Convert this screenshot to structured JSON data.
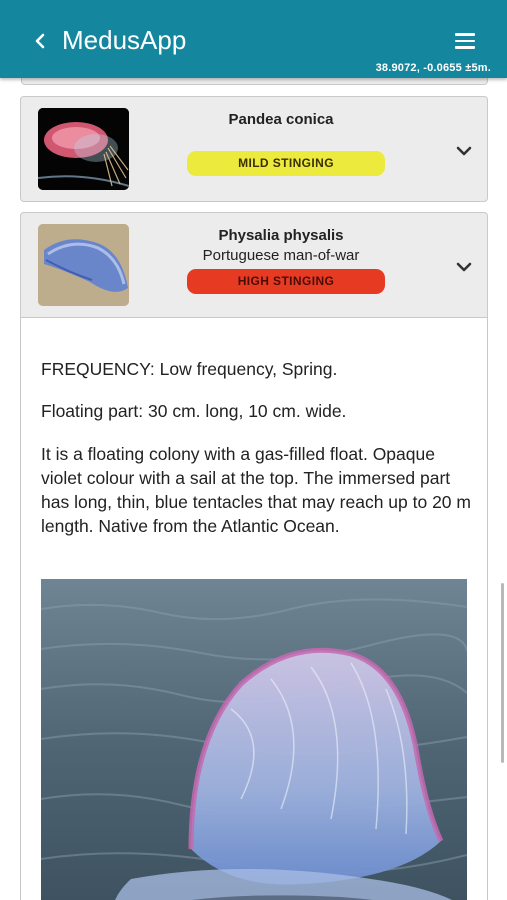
{
  "header": {
    "title": "MedusApp",
    "coordinates": "38.9072, -0.0655 ±5m.",
    "back_icon": "chevron-left-icon",
    "menu_icon": "hamburger-menu-icon",
    "background_color": "#14879f"
  },
  "cards": [
    {
      "species": "Pandea conica",
      "common_name": "",
      "sting_level": "MILD STINGING",
      "badge_color": "#ecea3c",
      "expand_icon": "chevron-down-icon"
    },
    {
      "species": "Physalia physalis",
      "common_name": "Portuguese man-of-war",
      "sting_level": "HIGH STINGING",
      "badge_color": "#e63a23",
      "expand_icon": "chevron-down-icon",
      "details": {
        "frequency": "FREQUENCY: Low frequency, Spring.",
        "floating_part": "Floating part: 30 cm. long, 10 cm. wide.",
        "description": "It is a floating colony with a gas-filled float. Opaque violet colour with a sail at the top. The immersed part has long, thin, blue tentacles that may reach up to 20 m length. Native from the Atlantic Ocean."
      }
    }
  ]
}
